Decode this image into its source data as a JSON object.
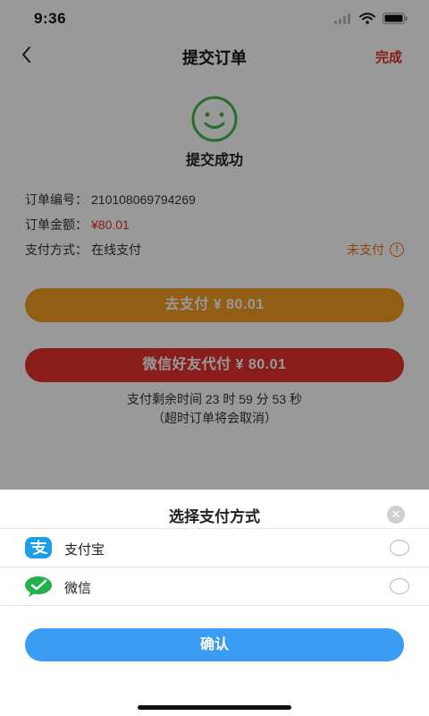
{
  "status_bar": {
    "time": "9:36"
  },
  "nav": {
    "title": "提交订单",
    "done": "完成"
  },
  "result": {
    "text": "提交成功"
  },
  "order": {
    "number_label": "订单编号：",
    "number_value": "210108069794269",
    "amount_label": "订单金额：",
    "amount_value": "¥80.01",
    "method_label": "支付方式：",
    "method_value": "在线支付",
    "pay_status": "未支付",
    "pay_status_icon_glyph": "!"
  },
  "buttons": {
    "pay": "去支付 ¥ 80.01",
    "wechat_friend_pay": "微信好友代付 ¥ 80.01"
  },
  "countdown": {
    "line1": "支付剩余时间 23 时 59 分 53 秒",
    "line2": "（超时订单将会取消）"
  },
  "sheet": {
    "title": "选择支付方式",
    "close_glyph": "✕",
    "options": [
      {
        "label": "支付宝",
        "icon": "alipay-icon",
        "selected": false
      },
      {
        "label": "微信",
        "icon": "wechat-icon",
        "selected": false
      }
    ],
    "confirm": "确认"
  },
  "colors": {
    "accent_red": "#e2312a",
    "pay_orange": "#f39b22",
    "wechat_friend_red": "#e3312c",
    "confirm_blue": "#3b9cf3",
    "success_green": "#3fb84f"
  }
}
